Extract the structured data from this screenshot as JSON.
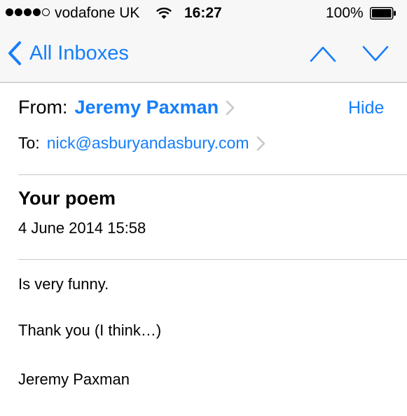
{
  "status_bar": {
    "signal_bars_filled": 4,
    "signal_bars_total": 5,
    "carrier": "vodafone UK",
    "time": "16:27",
    "battery_percent": "100%",
    "icons": [
      "signal-dots",
      "wifi-icon",
      "battery-icon"
    ]
  },
  "nav": {
    "back_label": "All Inboxes",
    "icons": [
      "chevron-left-icon",
      "chevron-up-icon",
      "chevron-down-icon"
    ],
    "accent_color": "#157efb"
  },
  "message": {
    "from_label": "From:",
    "from_name": "Jeremy Paxman",
    "hide_label": "Hide",
    "to_label": "To:",
    "to_address": "nick@asburyandasbury.com",
    "subject": "Your poem",
    "date": "4 June 2014 15:58",
    "body": [
      "Is very funny.",
      "Thank you (I think…)",
      "Jeremy Paxman"
    ]
  }
}
